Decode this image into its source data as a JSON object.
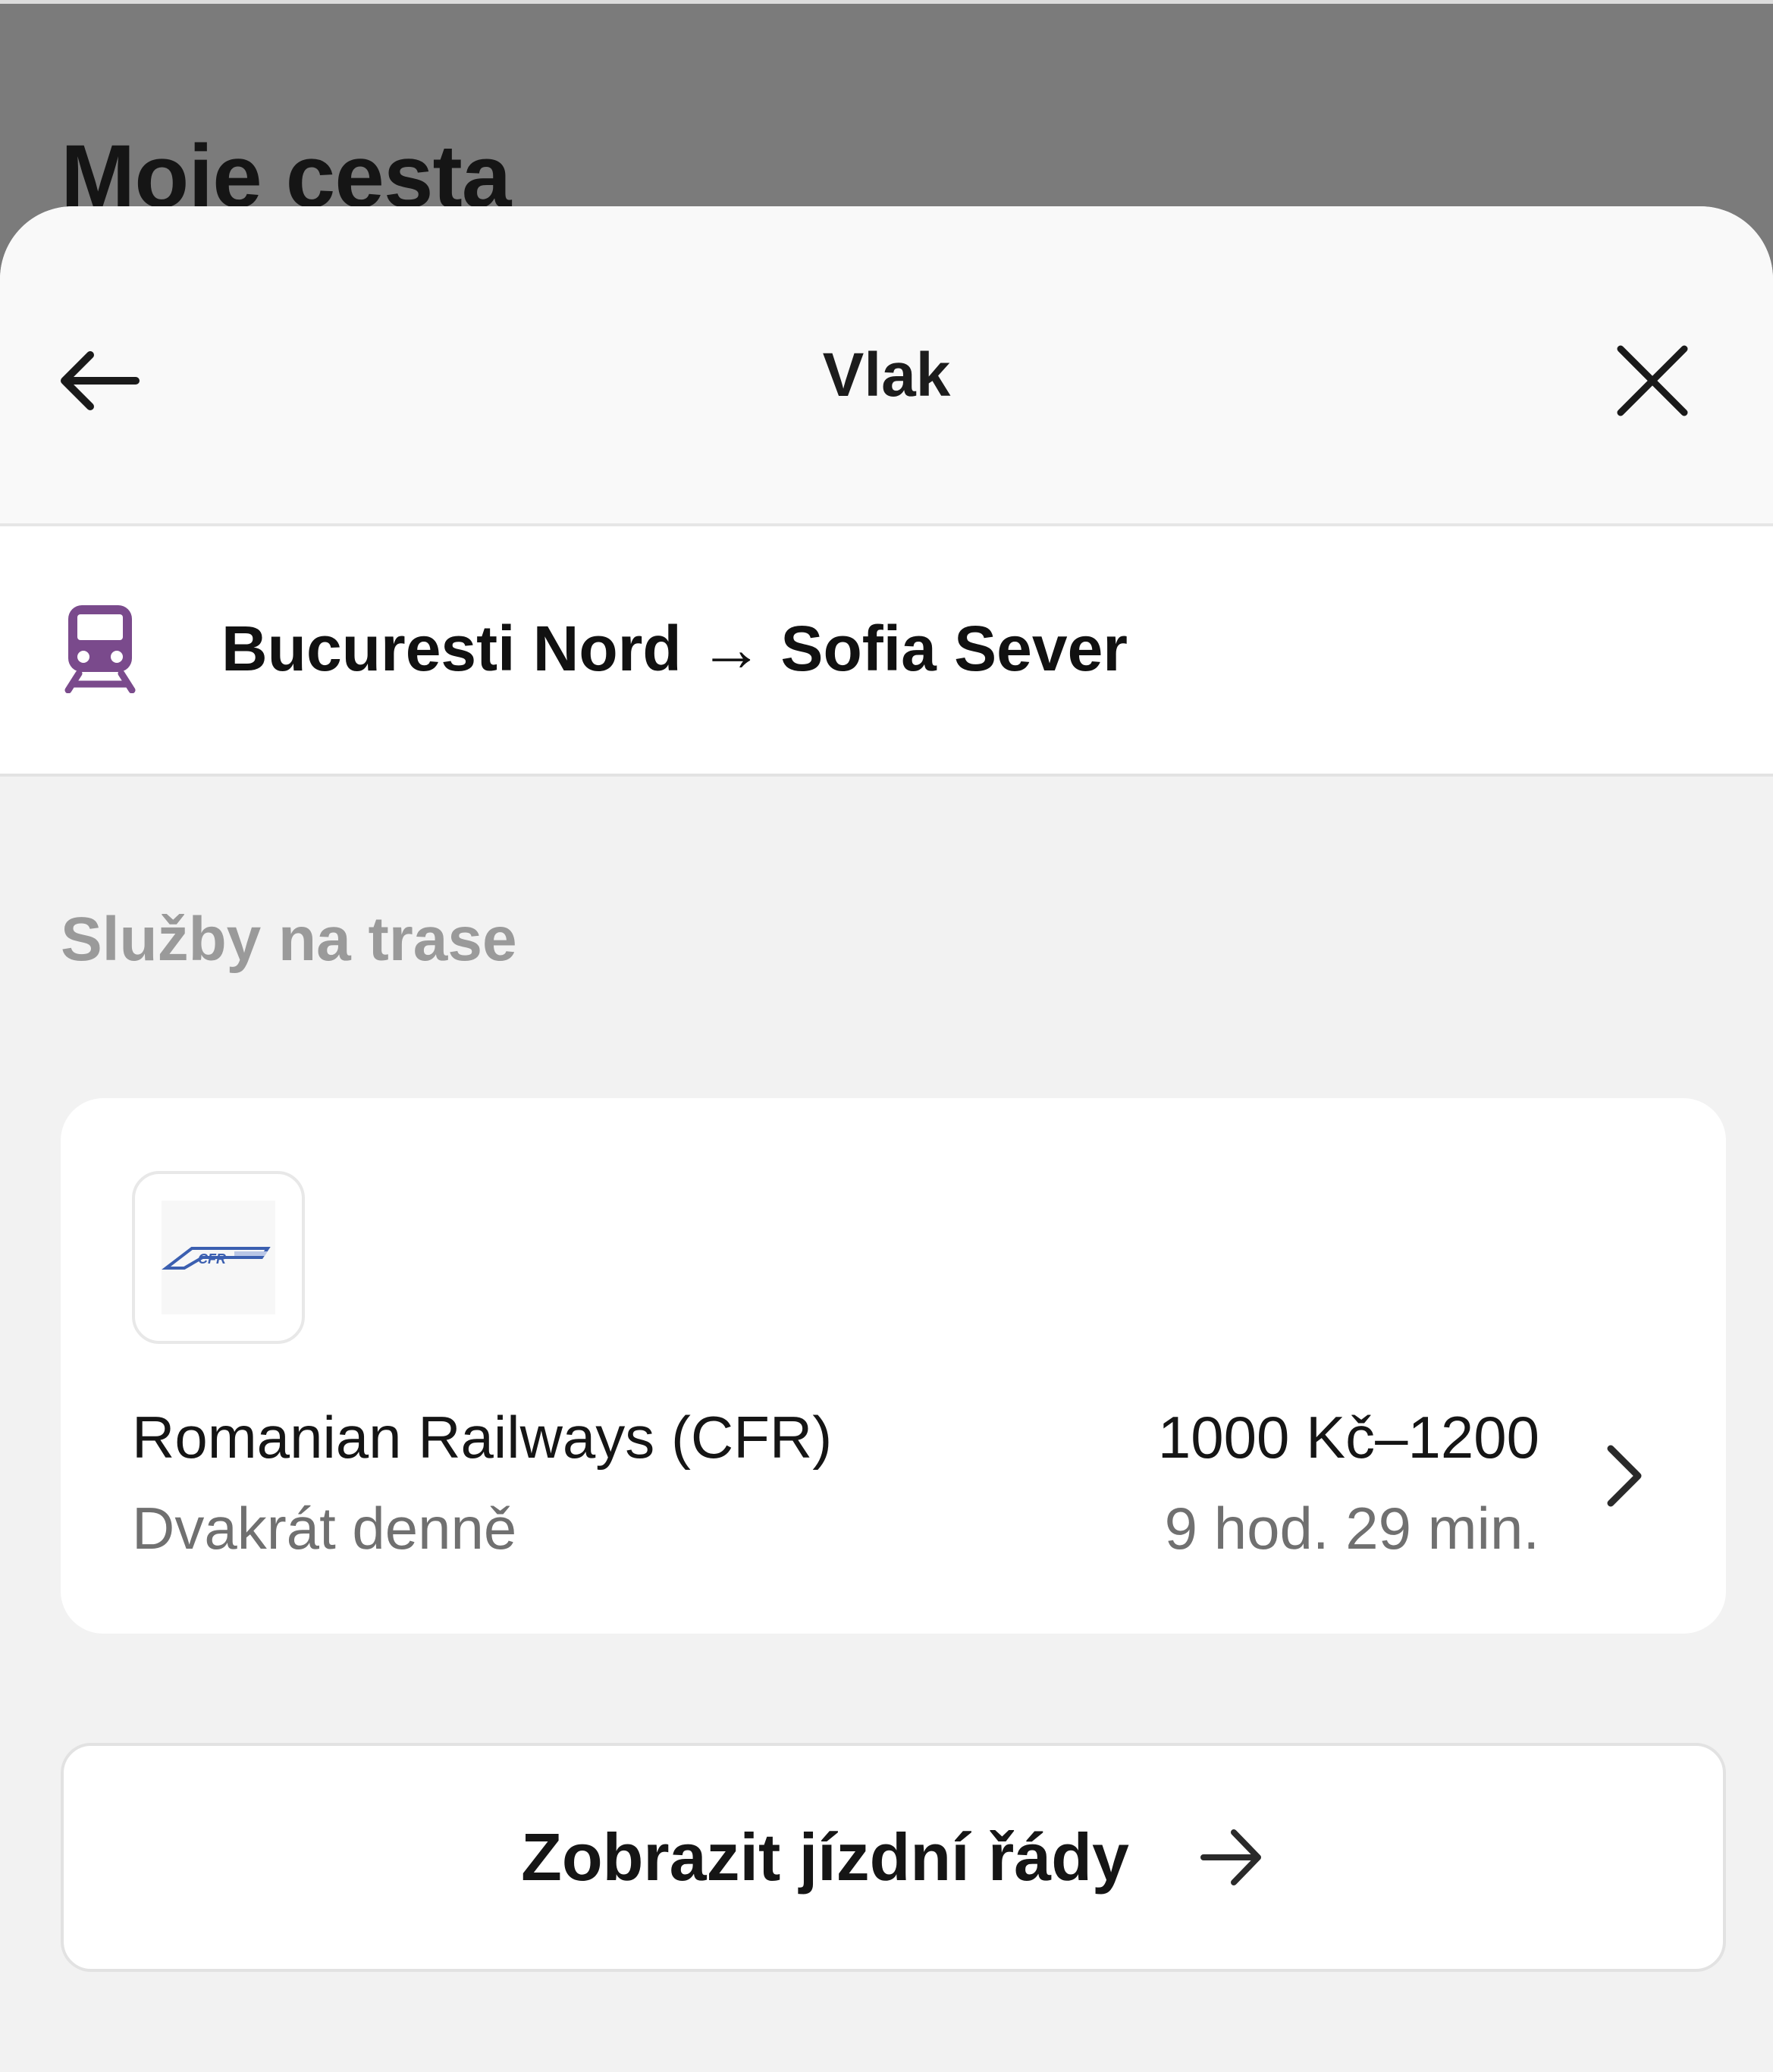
{
  "backdrop": {
    "title": "Moje cesta"
  },
  "sheet": {
    "title": "Vlak",
    "back_icon": "arrow-left-icon",
    "close_icon": "close-icon"
  },
  "route": {
    "icon": "train-icon",
    "label": "Bucuresti Nord → Sofia Sever",
    "icon_color": "#7a4a8c"
  },
  "services": {
    "section_title": "Služby na trase",
    "items": [
      {
        "logo_text": "CFR",
        "operator": "Romanian Railways (CFR)",
        "frequency": "Dvakrát denně",
        "price": "1000 Kč–1200",
        "duration": "9 hod. 29 min.",
        "chevron_icon": "chevron-right-icon"
      }
    ]
  },
  "timetable_button": {
    "label": "Zobrazit jízdní řády",
    "icon": "arrow-right-icon"
  }
}
